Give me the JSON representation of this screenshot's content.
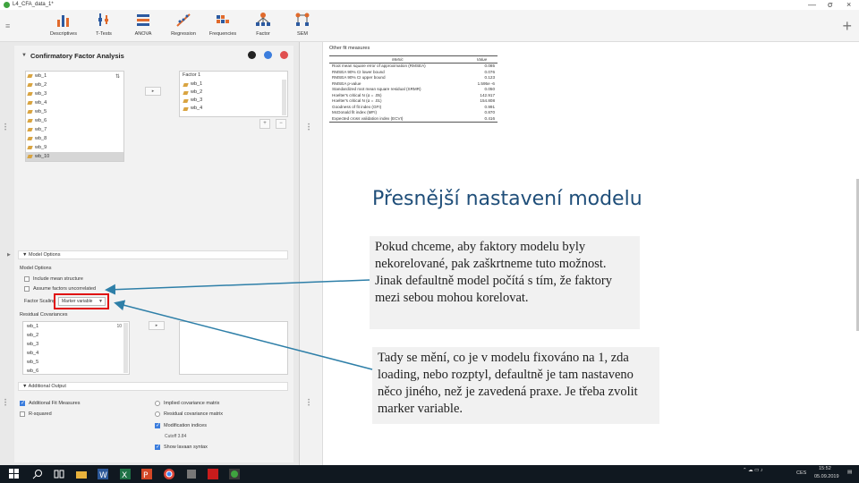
{
  "window": {
    "title": "L4_CFA_data_1*",
    "min": "—",
    "max": "σ",
    "close": "×"
  },
  "ribbon": {
    "items": [
      {
        "label": "Descriptives"
      },
      {
        "label": "T-Tests"
      },
      {
        "label": "ANOVA"
      },
      {
        "label": "Regression"
      },
      {
        "label": "Frequencies"
      },
      {
        "label": "Factor"
      },
      {
        "label": "SEM"
      }
    ],
    "add": "+",
    "menu": "≡"
  },
  "analysis": {
    "title": "Confirmatory Factor Analysis",
    "variables": [
      "wb_1",
      "wb_2",
      "wb_3",
      "wb_4",
      "wb_5",
      "wb_6",
      "wb_7",
      "wb_8",
      "wb_9",
      "wb_10"
    ],
    "selected_variable": "wb_10",
    "factor_name": "Factor 1",
    "factor_items": [
      "wb_1",
      "wb_2",
      "wb_3",
      "wb_4"
    ],
    "arrow": "▸",
    "add_factor": "+",
    "remove_factor": "−",
    "sort": "⇅",
    "model_options": {
      "header": "Model Options",
      "group_label": "Model Options",
      "include_mean": "Include mean structure",
      "assume_uncorrelated": "Assume factors uncorrelated",
      "factor_scaling_label": "Factor Scaling",
      "factor_scaling_value": "Marker variable"
    },
    "residual_covariances": {
      "label": "Residual Covariances",
      "items": [
        "wb_1",
        "wb_2",
        "wb_3",
        "wb_4",
        "wb_5",
        "wb_6"
      ],
      "count": "10"
    },
    "additional_output": {
      "header": "Additional Output",
      "additional_fit": "Additional Fit Measures",
      "r_squared": "R-squared",
      "implied_cov": "Implied covariance matrix",
      "residual_cov": "Residual covariance matrix",
      "modification": "Modification indices",
      "cutoff": "Cutoff  3.84",
      "show_lavaan": "Show lavaan syntax"
    }
  },
  "output": {
    "subtitle": "Other fit measures",
    "table": {
      "headers": [
        "Metric",
        "Value"
      ],
      "rows": [
        [
          "Root mean square error of approximation (RMSEA)",
          "0.085"
        ],
        [
          "RMSEA 90% CI lower bound",
          "0.076"
        ],
        [
          "RMSEA 90% CI upper bound",
          "0.123"
        ],
        [
          "RMSEA p-value",
          "1.595e -6"
        ],
        [
          "Standardized root mean square residual (SRMR)",
          "0.050"
        ],
        [
          "Hoelter's critical N (α = .05)",
          "142.917"
        ],
        [
          "Hoelter's critical N (α = .01)",
          "154.808"
        ],
        [
          "Goodness of fit index (GFI)",
          "0.991"
        ],
        [
          "McDonald fit index (MFI)",
          "0.870"
        ],
        [
          "Expected cross validation index (ECVI)",
          "0.416"
        ]
      ]
    }
  },
  "slide": {
    "title": "Přesnější nastavení modelu",
    "callout1": "Pokud chceme, aby faktory modelu byly nekorelované, pak zaškrtneme tuto možnost. Jinak defaultně model počítá s tím, že faktory mezi sebou mohou korelovat.",
    "callout2": "Tady se mění, co je v modelu fixováno na 1, zda loading, nebo rozptyl, defaultně je tam nastaveno něco jiného, než je zavedená praxe. Je třeba zvolit marker variable."
  },
  "taskbar": {
    "lang": "CES",
    "time": "15:52",
    "date": "05.09.2019"
  },
  "colors": {
    "accent": "#1f4e79",
    "highlight": "#e01010",
    "arrow": "#2e7fa8"
  }
}
